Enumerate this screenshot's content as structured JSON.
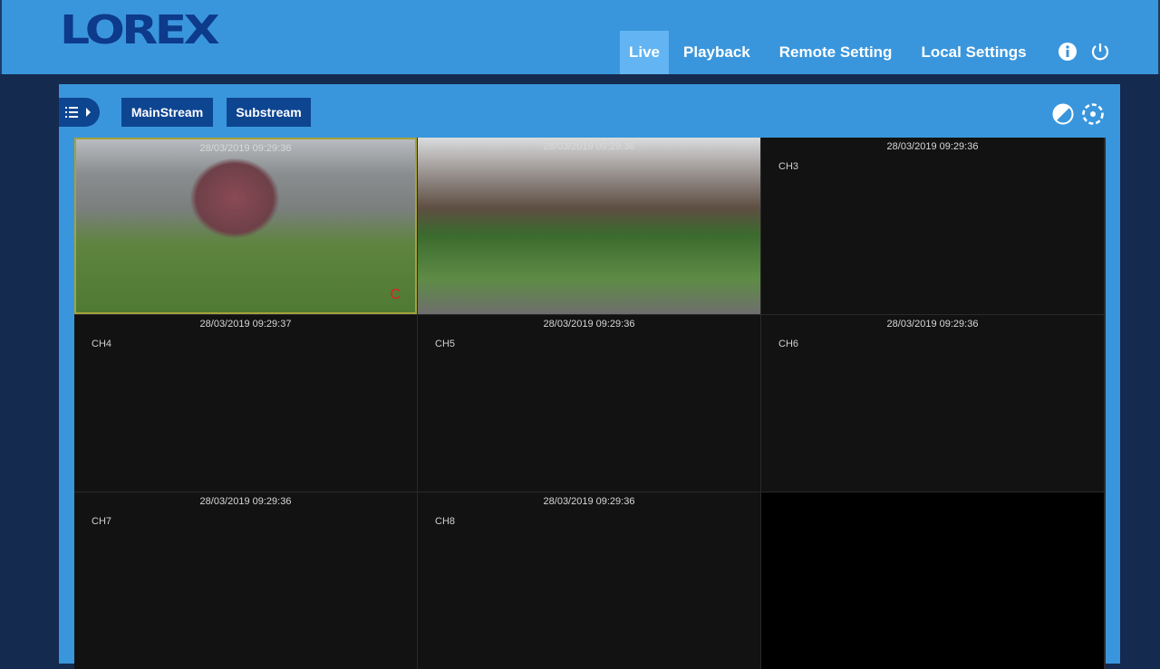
{
  "header": {
    "logo": "LOREX",
    "nav": [
      "Live",
      "Playback",
      "Remote Setting",
      "Local Settings"
    ],
    "active": "Live"
  },
  "toolbar": {
    "main_stream": "MainStream",
    "substream": "Substream"
  },
  "channels": [
    {
      "timestamp": "28/03/2019 09:29:36",
      "label": "",
      "video": true,
      "indicator": "C"
    },
    {
      "timestamp": "28/03/2019 09:29:36",
      "label": "",
      "video": true
    },
    {
      "timestamp": "28/03/2019 09:29:36",
      "label": "CH3"
    },
    {
      "timestamp": "28/03/2019 09:29:37",
      "label": "CH4"
    },
    {
      "timestamp": "28/03/2019 09:29:36",
      "label": "CH5"
    },
    {
      "timestamp": "28/03/2019 09:29:36",
      "label": "CH6"
    },
    {
      "timestamp": "28/03/2019 09:29:36",
      "label": "CH7"
    },
    {
      "timestamp": "28/03/2019 09:29:36",
      "label": "CH8"
    }
  ],
  "colors": {
    "brand_blue": "#3a96dc",
    "dark_navy": "#152a4f",
    "button": "#0d4591",
    "record": "#e02020"
  }
}
